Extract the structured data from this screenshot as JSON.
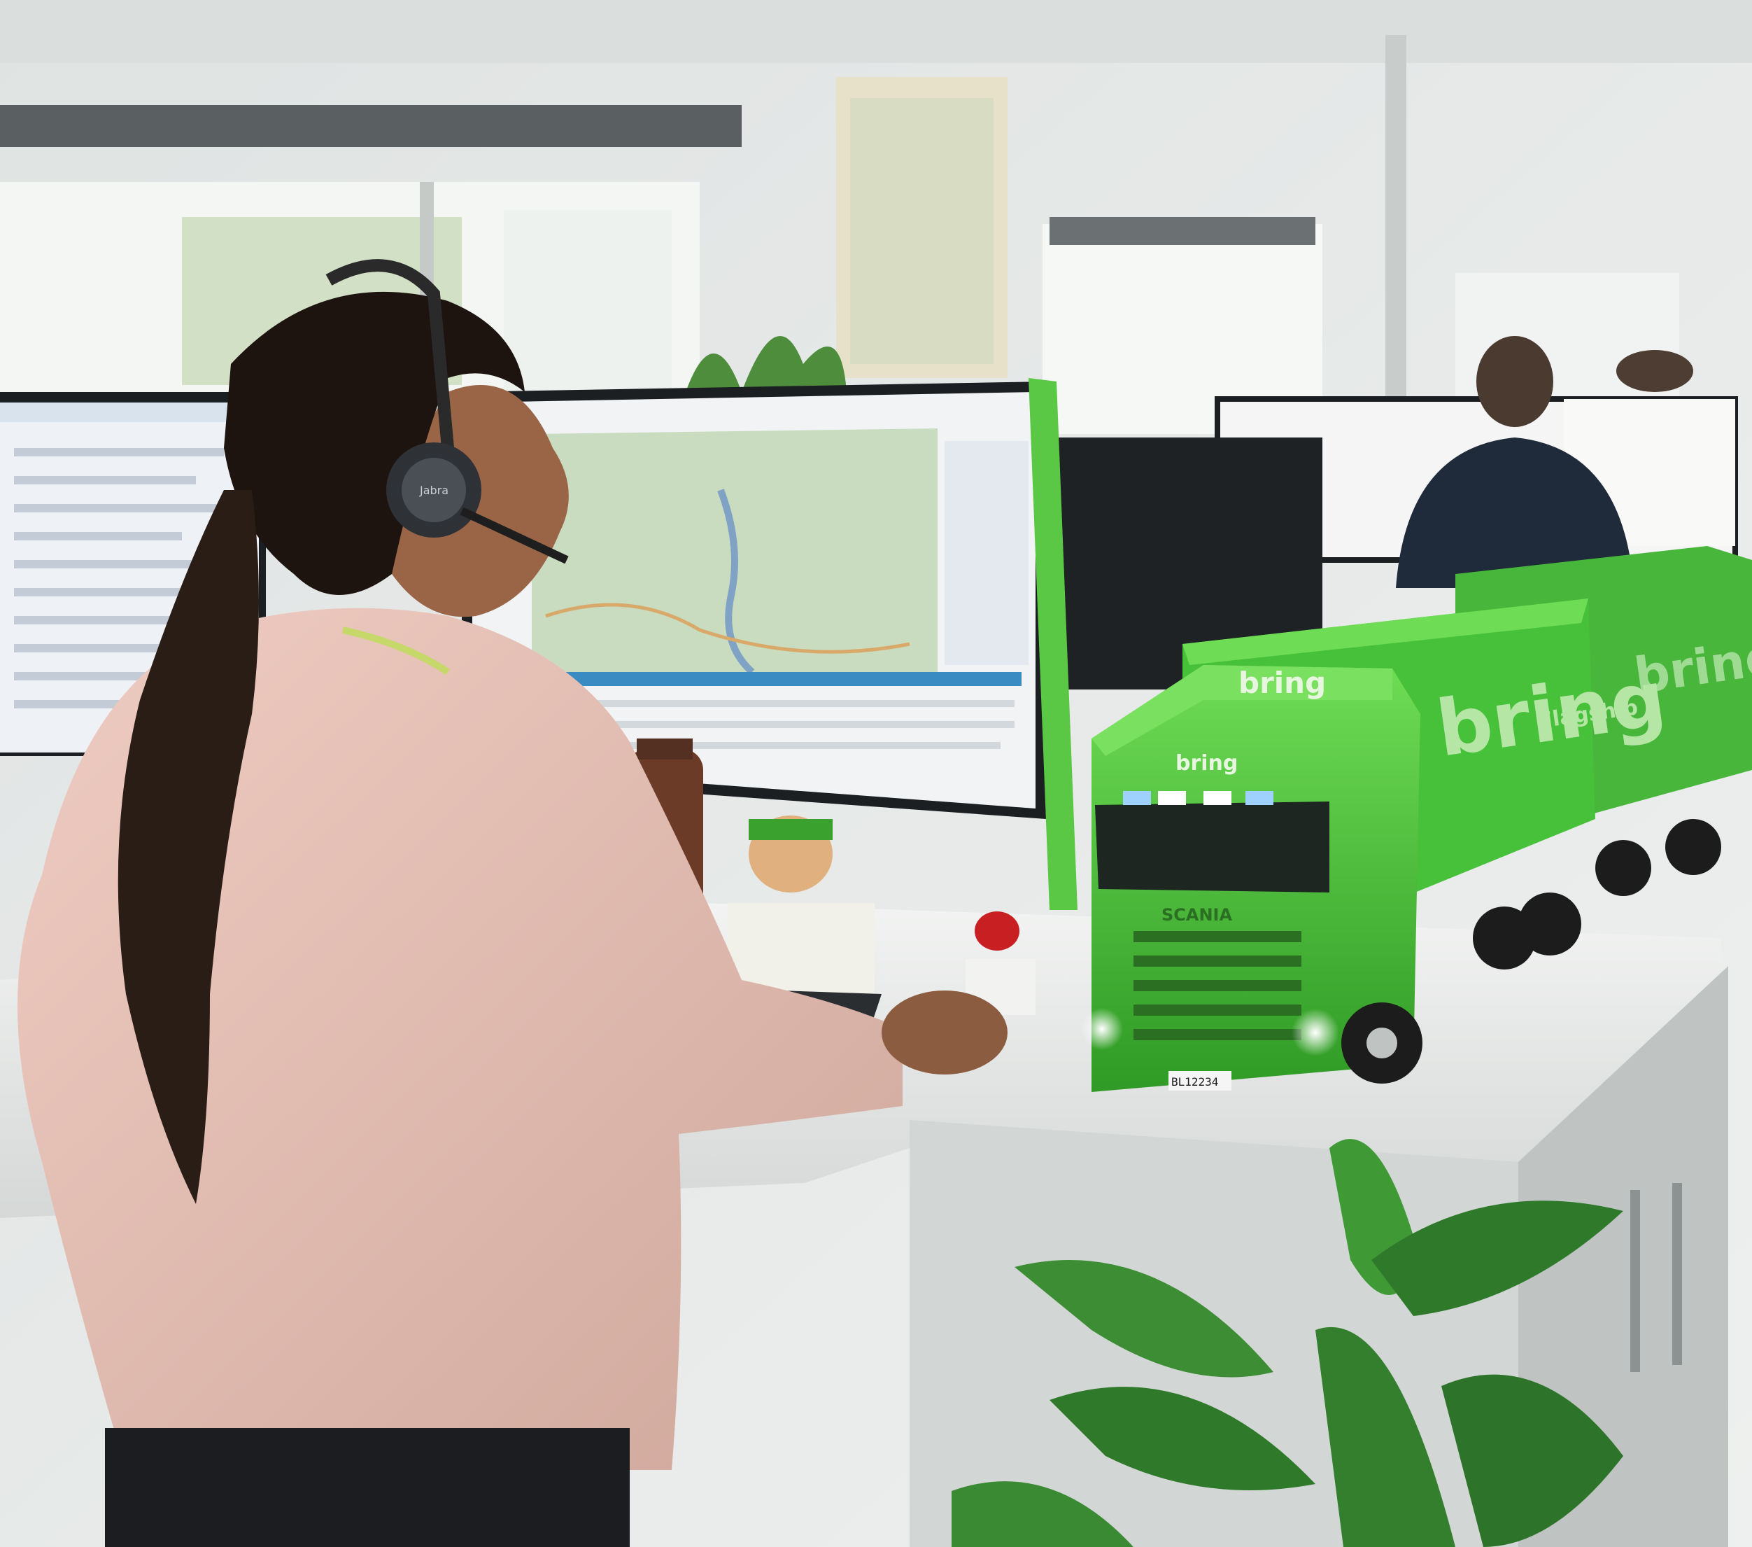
{
  "photo": {
    "brand_text_trailer": "bring",
    "brand_text_cab_top": "bring",
    "brand_text_cab_front": "bring",
    "brand_text_container": "bring",
    "container_subtitle": "Flagship",
    "grille_text": "SCANIA",
    "license_plate": "BL12234",
    "headset_brand": "Jabra"
  },
  "colors": {
    "wall": "#e7e9e8",
    "window_light": "#f4f6f3",
    "truck_green": "#4cc63a",
    "truck_green_dark": "#2f8e25",
    "sweater": "#e3bdb2",
    "hair": "#1d1410",
    "desk": "#ecedec",
    "cabinet": "#d7dad9",
    "monitor_frame": "#1c1f22",
    "map_green": "#c9dcc0",
    "leaf_green": "#2f7a2a"
  }
}
